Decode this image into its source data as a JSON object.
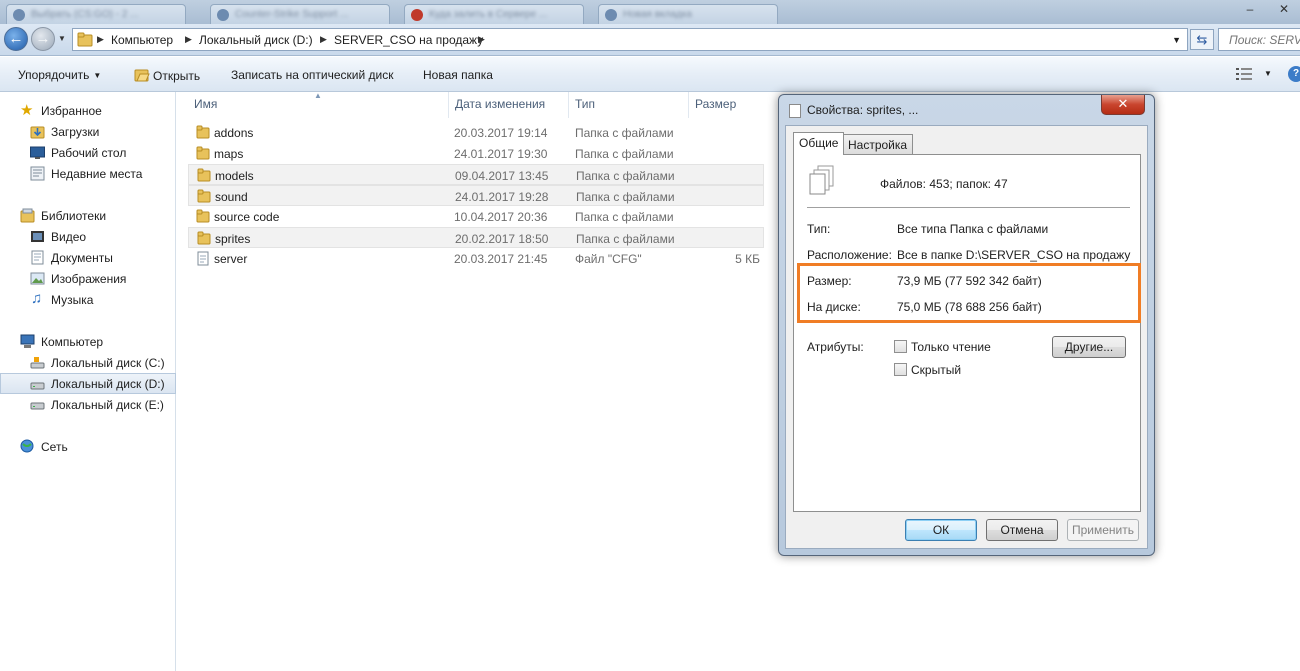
{
  "browser_tabs": [
    {
      "label": "Выбрать (CS:GO) - 2 ..."
    },
    {
      "label": "Counter-Strike Support ..."
    },
    {
      "label": "Куда залить в Сервере ..."
    },
    {
      "label": "Новая вкладка"
    }
  ],
  "window_controls": {
    "minimize": "–",
    "close": "✕"
  },
  "address": {
    "crumbs": [
      "Компьютер",
      "Локальный диск (D:)",
      "SERVER_CSO на продажу"
    ],
    "search_placeholder": "Поиск: SERVER_CSO на продажу"
  },
  "toolbar": {
    "organize": "Упорядочить",
    "open": "Открыть",
    "burn": "Записать на оптический диск",
    "new_folder": "Новая папка",
    "help": "?"
  },
  "sidebar": {
    "favorites": {
      "label": "Избранное",
      "items": [
        "Загрузки",
        "Рабочий стол",
        "Недавние места"
      ]
    },
    "libraries": {
      "label": "Библиотеки",
      "items": [
        "Видео",
        "Документы",
        "Изображения",
        "Музыка"
      ]
    },
    "computer": {
      "label": "Компьютер",
      "items": [
        "Локальный диск (C:)",
        "Локальный диск (D:)",
        "Локальный диск (E:)"
      ]
    },
    "network": {
      "label": "Сеть"
    }
  },
  "columns": {
    "name": "Имя",
    "date": "Дата изменения",
    "type": "Тип",
    "size": "Размер"
  },
  "files": [
    {
      "name": "addons",
      "date": "20.03.2017 19:14",
      "type": "Папка с файлами",
      "size": "",
      "kind": "folder",
      "highlight": false
    },
    {
      "name": "maps",
      "date": "24.01.2017 19:30",
      "type": "Папка с файлами",
      "size": "",
      "kind": "folder",
      "highlight": false
    },
    {
      "name": "models",
      "date": "09.04.2017 13:45",
      "type": "Папка с файлами",
      "size": "",
      "kind": "folder",
      "highlight": true
    },
    {
      "name": "sound",
      "date": "24.01.2017 19:28",
      "type": "Папка с файлами",
      "size": "",
      "kind": "folder",
      "highlight": true
    },
    {
      "name": "source code",
      "date": "10.04.2017 20:36",
      "type": "Папка с файлами",
      "size": "",
      "kind": "folder",
      "highlight": false
    },
    {
      "name": "sprites",
      "date": "20.02.2017 18:50",
      "type": "Папка с файлами",
      "size": "",
      "kind": "folder",
      "highlight": true
    },
    {
      "name": "server",
      "date": "20.03.2017 21:45",
      "type": "Файл \"CFG\"",
      "size": "5 КБ",
      "kind": "file",
      "highlight": false
    }
  ],
  "dialog": {
    "title": "Свойства: sprites, ...",
    "close": "✕",
    "tabs": [
      "Общие",
      "Настройка"
    ],
    "summary": "Файлов: 453; папок: 47",
    "type_label": "Тип:",
    "type_value": "Все типа Папка с файлами",
    "location_label": "Расположение:",
    "location_value": "Все в папке D:\\SERVER_CSO на продажу",
    "size_label": "Размер:",
    "size_value": "73,9 МБ (77 592 342 байт)",
    "disk_label": "На диске:",
    "disk_value": "75,0 МБ (78 688 256 байт)",
    "attributes_label": "Атрибуты:",
    "readonly": "Только чтение",
    "hidden": "Скрытый",
    "other_button": "Другие...",
    "ok": "ОК",
    "cancel": "Отмена",
    "apply": "Применить"
  },
  "colors": {
    "highlight_border": "#f07d25",
    "folder": "#e8c25b",
    "accent": "#3c7fb1"
  }
}
